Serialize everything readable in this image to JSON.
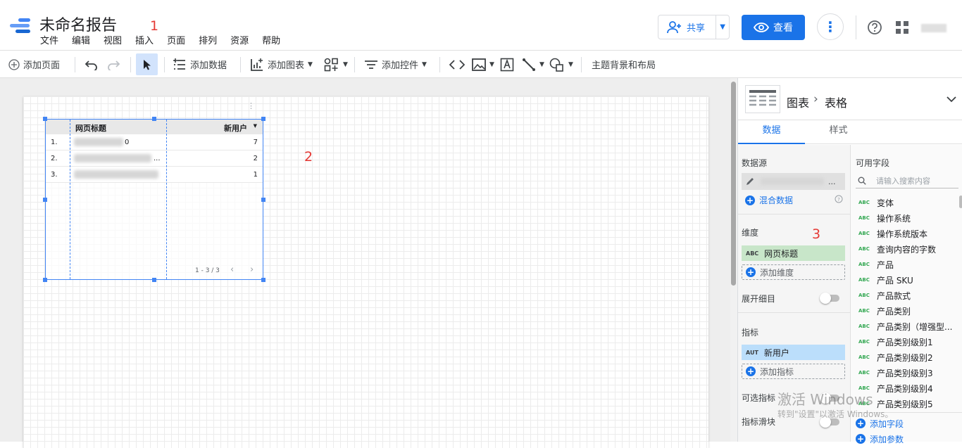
{
  "app": {
    "title": "未命名报告",
    "menu": [
      "文件",
      "编辑",
      "视图",
      "插入",
      "页面",
      "排列",
      "资源",
      "帮助"
    ],
    "annotations": [
      "1",
      "2",
      "3"
    ]
  },
  "header": {
    "share_label": "共享",
    "view_label": "查看"
  },
  "toolbar": {
    "add_page": "添加页面",
    "add_data": "添加数据",
    "add_chart": "添加图表",
    "add_control": "添加控件",
    "theme_layout": "主题背景和布局"
  },
  "table": {
    "columns": [
      "网页标题",
      "新用户"
    ],
    "rows": [
      {
        "index": "1.",
        "title_suffix": "0",
        "value": "7"
      },
      {
        "index": "2.",
        "title_suffix": "...",
        "value": "2"
      },
      {
        "index": "3.",
        "title_suffix": "",
        "value": "1"
      }
    ],
    "pagination": "1 - 3 / 3"
  },
  "panel": {
    "breadcrumb_chart": "图表",
    "breadcrumb_sep": "›",
    "breadcrumb_type": "表格",
    "tabs": [
      "数据",
      "样式"
    ],
    "data_source_label": "数据源",
    "data_source_suffix": "...",
    "blend_label": "混合数据",
    "dimension_label": "维度",
    "dimension_tag": "ABC",
    "dimension_value": "网页标题",
    "add_dimension": "添加维度",
    "drilldown_label": "展开细目",
    "metric_label": "指标",
    "metric_tag": "AUT",
    "metric_value": "新用户",
    "add_metric": "添加指标",
    "optional_metrics": "可选指标",
    "metric_slider": "指标滑块",
    "available_fields": "可用字段",
    "search_placeholder": "请输入搜索内容",
    "field_tag": "ABC",
    "fields": [
      "变体",
      "操作系统",
      "操作系统版本",
      "查询内容的字数",
      "产品",
      "产品 SKU",
      "产品款式",
      "产品类别",
      "产品类别（增强型...",
      "产品类别级别1",
      "产品类别级别2",
      "产品类别级别3",
      "产品类别级别4",
      "产品类别级别5"
    ],
    "add_field": "添加字段",
    "add_param": "添加参数"
  },
  "watermark": {
    "line1": "激活 Windows",
    "line2": "转到\"设置\"以激活 Windows。"
  },
  "colors": {
    "accent": "#1a73e8",
    "selection": "#4285f4",
    "dimension_bg": "#c8e6c9",
    "metric_bg": "#bbdefb",
    "annotation": "#e53935"
  }
}
